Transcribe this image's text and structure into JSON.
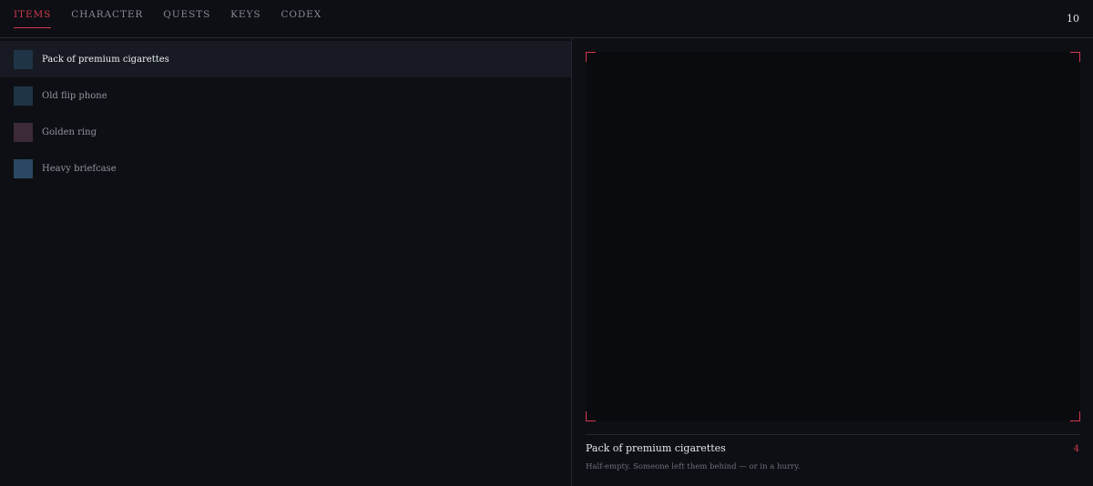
{
  "nav": {
    "tabs": [
      {
        "label": "ITEMS",
        "active": true
      },
      {
        "label": "CHARACTER",
        "active": false
      },
      {
        "label": "QUESTS",
        "active": false
      },
      {
        "label": "KEYS",
        "active": false
      },
      {
        "label": "CODEX",
        "active": false
      }
    ],
    "counter": "10"
  },
  "inventory": {
    "items": [
      {
        "label": "Pack of premium cigarettes",
        "color": "#1f3446",
        "selected": true
      },
      {
        "label": "Old flip phone",
        "color": "#1f3446",
        "selected": false
      },
      {
        "label": "Golden ring",
        "color": "#3c2a38",
        "selected": false
      },
      {
        "label": "Heavy briefcase",
        "color": "#2a4863",
        "selected": false
      }
    ]
  },
  "detail": {
    "title": "Pack of premium cigarettes",
    "quantity": "4",
    "description": "Half-empty. Someone left them behind — or in a hurry."
  },
  "colors": {
    "accent": "#d2384e",
    "background": "#0d0f14"
  }
}
